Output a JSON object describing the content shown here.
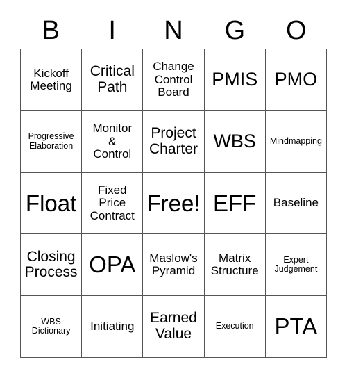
{
  "card": {
    "title": "BINGO",
    "header_letters": [
      "B",
      "I",
      "N",
      "G",
      "O"
    ],
    "grid_size": "5x5",
    "free_space": "Free!",
    "colors": {
      "background": "#ffffff",
      "text": "#000000",
      "border": "#555555"
    },
    "rows": [
      [
        {
          "text": "Kickoff\nMeeting",
          "size": "sm"
        },
        {
          "text": "Critical\nPath",
          "size": "md"
        },
        {
          "text": "Change\nControl\nBoard",
          "size": "sm"
        },
        {
          "text": "PMIS",
          "size": "lg"
        },
        {
          "text": "PMO",
          "size": "lg"
        }
      ],
      [
        {
          "text": "Progressive\nElaboration",
          "size": "xs"
        },
        {
          "text": "Monitor\n&\nControl",
          "size": "sm"
        },
        {
          "text": "Project\nCharter",
          "size": "md"
        },
        {
          "text": "WBS",
          "size": "lg"
        },
        {
          "text": "Mindmapping",
          "size": "xs"
        }
      ],
      [
        {
          "text": "Float",
          "size": "xl"
        },
        {
          "text": "Fixed\nPrice\nContract",
          "size": "sm"
        },
        {
          "text": "Free!",
          "size": "xl"
        },
        {
          "text": "EFF",
          "size": "xl"
        },
        {
          "text": "Baseline",
          "size": "sm"
        }
      ],
      [
        {
          "text": "Closing\nProcess",
          "size": "md"
        },
        {
          "text": "OPA",
          "size": "xl"
        },
        {
          "text": "Maslow's\nPyramid",
          "size": "sm"
        },
        {
          "text": "Matrix\nStructure",
          "size": "sm"
        },
        {
          "text": "Expert\nJudgement",
          "size": "xs"
        }
      ],
      [
        {
          "text": "WBS\nDictionary",
          "size": "xs"
        },
        {
          "text": "Initiating",
          "size": "sm"
        },
        {
          "text": "Earned\nValue",
          "size": "md"
        },
        {
          "text": "Execution",
          "size": "xs"
        },
        {
          "text": "PTA",
          "size": "xl"
        }
      ]
    ]
  }
}
